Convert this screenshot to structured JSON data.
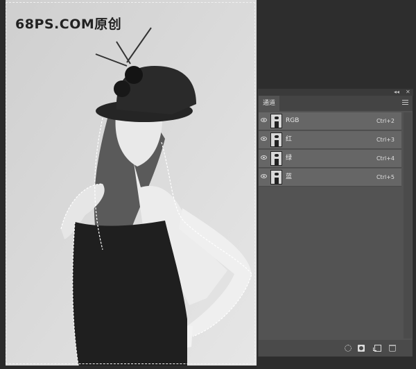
{
  "watermark": "68PS.COM原创",
  "panel": {
    "tab_label": "通道",
    "strip_collapse": "◂◂",
    "strip_close": "✕"
  },
  "channels": [
    {
      "name": "RGB",
      "shortcut": "Ctrl+2",
      "visible": true
    },
    {
      "name": "红",
      "shortcut": "Ctrl+3",
      "visible": true
    },
    {
      "name": "绿",
      "shortcut": "Ctrl+4",
      "visible": true
    },
    {
      "name": "蓝",
      "shortcut": "Ctrl+5",
      "visible": true
    }
  ],
  "footer_icons": [
    "load-selection-icon",
    "save-selection-mask-icon",
    "new-channel-icon",
    "delete-channel-icon"
  ]
}
